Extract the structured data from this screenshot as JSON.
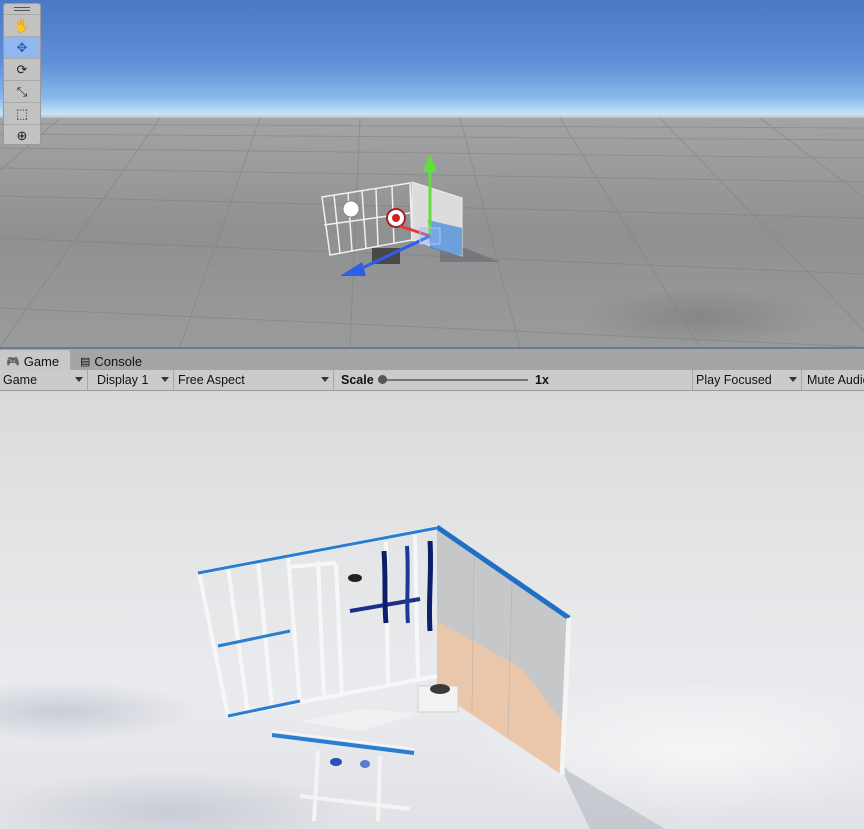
{
  "tool_palette": {
    "tools": [
      {
        "name": "hand-tool",
        "glyph": "✋"
      },
      {
        "name": "move-tool",
        "glyph": "✥",
        "active": true
      },
      {
        "name": "rotate-tool",
        "glyph": "⟳"
      },
      {
        "name": "scale-tool",
        "glyph": "⤡"
      },
      {
        "name": "rect-tool",
        "glyph": "⬚"
      },
      {
        "name": "transform-tool",
        "glyph": "⊕"
      }
    ]
  },
  "tabs": {
    "game": "Game",
    "console": "Console"
  },
  "toolbar": {
    "view_mode": "Game",
    "display": "Display 1",
    "aspect": "Free Aspect",
    "scale_label": "Scale",
    "scale_value": "1x",
    "play_mode": "Play Focused",
    "mute": "Mute Audio"
  },
  "colors": {
    "active_tool": "#92b6ee",
    "gizmo_y": "#5fe03a",
    "gizmo_x": "#e03a3a",
    "gizmo_z": "#2d5fe8"
  }
}
